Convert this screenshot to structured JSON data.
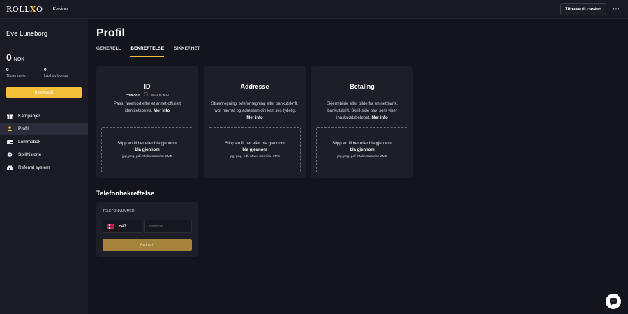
{
  "topbar": {
    "logo_left": "ROLL",
    "logo_mark": "X",
    "logo_right": "O",
    "nav_casino": "Kasino",
    "back_label": "Tilbake til casino",
    "more_icon": "⋯"
  },
  "sidebar": {
    "user_name": "Eve Luneborg",
    "balance": "0",
    "currency": "NOK",
    "stats": [
      {
        "value": "0",
        "label": "Tilgjengelig"
      },
      {
        "value": "0",
        "label": "Låst av bonus"
      }
    ],
    "deposit_label": "Innskudd",
    "items": [
      {
        "label": "Kampanjer",
        "icon": "gift-icon"
      },
      {
        "label": "Profil",
        "icon": "user-icon"
      },
      {
        "label": "Lommebok",
        "icon": "wallet-icon"
      },
      {
        "label": "Spillhistorie",
        "icon": "history-icon"
      },
      {
        "label": "Referral system",
        "icon": "referral-icon"
      }
    ]
  },
  "main": {
    "title": "Profil",
    "tabs": [
      {
        "label": "GENERELL"
      },
      {
        "label": "BEKREFTELSE"
      },
      {
        "label": "SIKKERHET"
      }
    ],
    "cards": [
      {
        "title": "ID",
        "toggle_primary": "PRIMARY",
        "toggle_secondary": "SELFIE & ID",
        "desc": "Pass, førerkort eller et annet offisielt identitetsbevis.",
        "more": "Mer info"
      },
      {
        "title": "Addresse",
        "desc": "Strømregning, telefonregning eller bankutskrift, hvor navnet og adressen din kan ses tydelig.",
        "more": "Mer info"
      },
      {
        "title": "Betaling",
        "desc": "Skjermbilde eller bilde fra en nettbank, bankutskrift, Skrill-side osv. som viser innskuddsbeløpet.",
        "more": "Mer info"
      }
    ],
    "dropzone": {
      "line1": "Slipp en fil her eller bla gjennom",
      "line2": "bla gjennom",
      "line3": "jpg, png, pdf. Maks størrelse 2MB"
    },
    "phone": {
      "title": "Telefonbekreftelse",
      "label": "TELEFONNUMMER",
      "code": "+47",
      "placeholder": "Nummer",
      "verify_label": "Bekreft"
    }
  },
  "colors": {
    "accent": "#f3bf3a",
    "background": "#13141c",
    "sidebar": "#1a1b24",
    "card": "#1d1e28"
  }
}
